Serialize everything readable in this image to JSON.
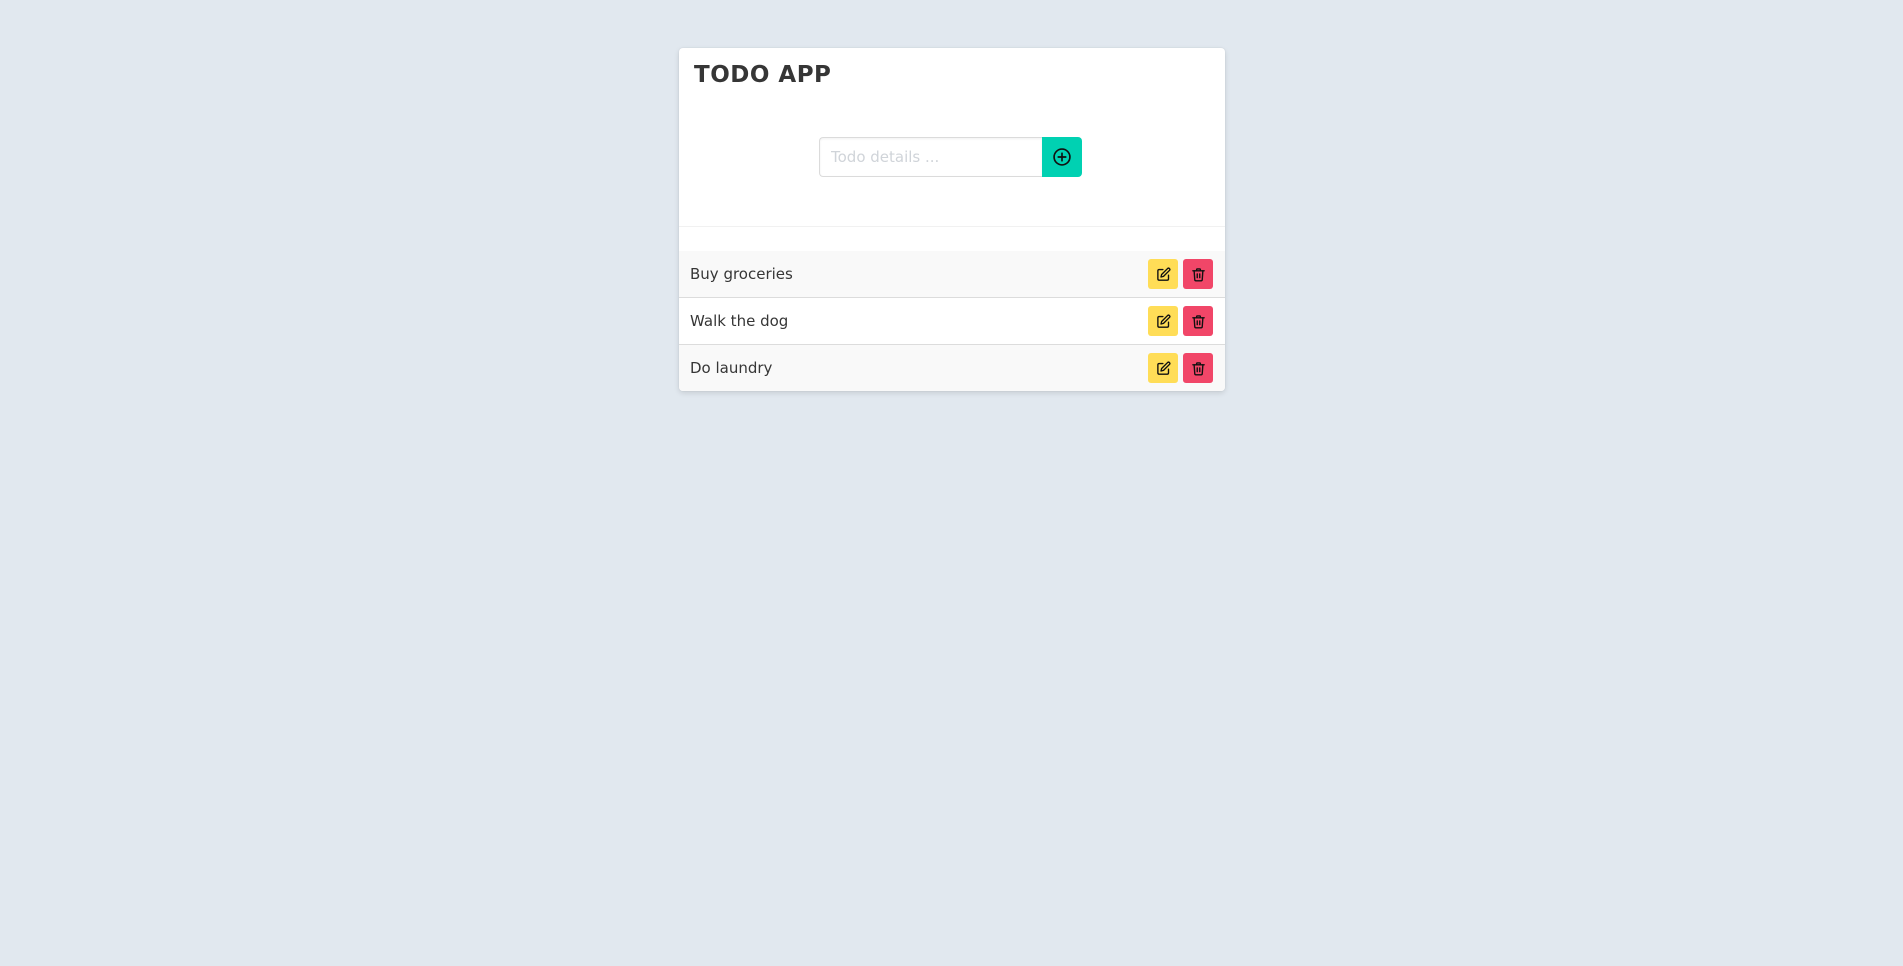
{
  "app": {
    "title": "TODO APP"
  },
  "form": {
    "placeholder": "Todo details ...",
    "value": "",
    "add_icon": "plus-circle-icon"
  },
  "colors": {
    "background": "#e1e8ef",
    "add_button": "#00d1b2",
    "edit_button": "#ffdd57",
    "delete_button": "#f14668"
  },
  "todos": [
    {
      "text": "Buy groceries",
      "edit_icon": "edit-icon",
      "delete_icon": "trash-icon"
    },
    {
      "text": "Walk the dog",
      "edit_icon": "edit-icon",
      "delete_icon": "trash-icon"
    },
    {
      "text": "Do laundry",
      "edit_icon": "edit-icon",
      "delete_icon": "trash-icon"
    }
  ]
}
